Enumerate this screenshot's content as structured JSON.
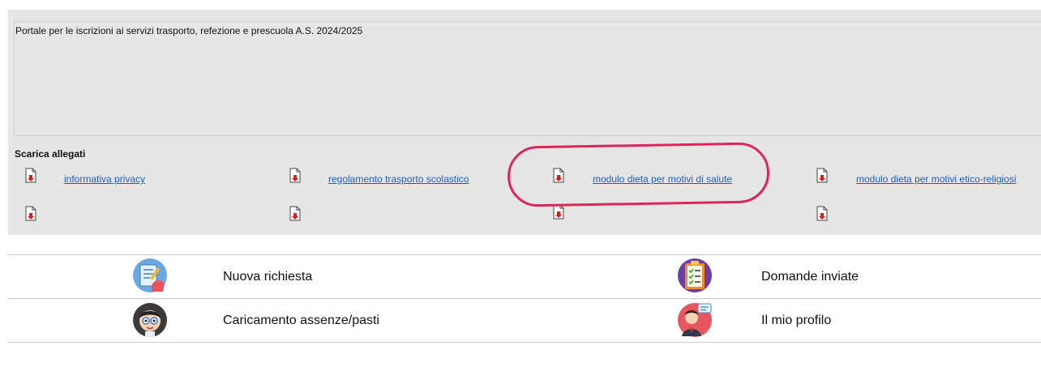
{
  "portal": {
    "description": "Portale per le iscrizioni ai servizi trasporto, refezione e prescuola A.S. 2024/2025"
  },
  "attachments": {
    "title": "Scarica allegati",
    "items": [
      {
        "label": "informativa privacy"
      },
      {
        "label": "regolamento trasporto scolastico"
      },
      {
        "label": "modulo dieta per motivi di salute"
      },
      {
        "label": "modulo dieta per motivi etico-religiosi"
      }
    ]
  },
  "menu": {
    "items": [
      {
        "label": "Nuova richiesta",
        "icon": "new-request-icon"
      },
      {
        "label": "Domande inviate",
        "icon": "sent-applications-icon"
      },
      {
        "label": "Caricamento assenze/pasti",
        "icon": "absences-meals-icon"
      },
      {
        "label": "Il mio profilo",
        "icon": "profile-icon"
      }
    ]
  },
  "colors": {
    "panel_bg": "#e6e6e6",
    "link": "#1a5ec9",
    "highlight": "#e0245e",
    "download_arrow": "#e01b1b"
  }
}
